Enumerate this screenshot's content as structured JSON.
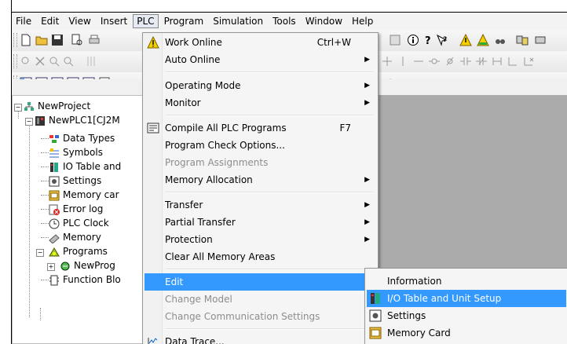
{
  "menubar": {
    "items": [
      {
        "label": "File"
      },
      {
        "label": "Edit"
      },
      {
        "label": "View"
      },
      {
        "label": "Insert"
      },
      {
        "label": "PLC"
      },
      {
        "label": "Program"
      },
      {
        "label": "Simulation"
      },
      {
        "label": "Tools"
      },
      {
        "label": "Window"
      },
      {
        "label": "Help"
      }
    ]
  },
  "tree": {
    "items": [
      {
        "label": "NewProject"
      },
      {
        "label": "NewPLC1[CJ2M"
      },
      {
        "label": "Data Types"
      },
      {
        "label": "Symbols"
      },
      {
        "label": "IO Table and"
      },
      {
        "label": "Settings"
      },
      {
        "label": "Memory car"
      },
      {
        "label": "Error log"
      },
      {
        "label": "PLC Clock"
      },
      {
        "label": "Memory"
      },
      {
        "label": "Programs"
      },
      {
        "label": "NewProg"
      },
      {
        "label": "Function Blo"
      }
    ]
  },
  "plc_menu": {
    "items": [
      {
        "label": "Work Online",
        "shortcut": "Ctrl+W"
      },
      {
        "label": "Auto Online"
      },
      {
        "label": "Operating Mode"
      },
      {
        "label": "Monitor"
      },
      {
        "label": "Compile All PLC Programs",
        "shortcut": "F7"
      },
      {
        "label": "Program Check Options..."
      },
      {
        "label": "Program Assignments"
      },
      {
        "label": "Memory Allocation"
      },
      {
        "label": "Transfer"
      },
      {
        "label": "Partial Transfer"
      },
      {
        "label": "Protection"
      },
      {
        "label": "Clear All Memory Areas"
      },
      {
        "label": "Edit"
      },
      {
        "label": "Change Model"
      },
      {
        "label": "Change Communication Settings"
      },
      {
        "label": "Data Trace..."
      }
    ]
  },
  "edit_submenu": {
    "items": [
      {
        "label": "Information"
      },
      {
        "label": "I/O Table and Unit Setup"
      },
      {
        "label": "Settings"
      },
      {
        "label": "Memory Card"
      }
    ]
  },
  "colors": {
    "highlight": "#3399ff",
    "menu_bg": "#f5f5f5",
    "workspace": "#ababab"
  }
}
